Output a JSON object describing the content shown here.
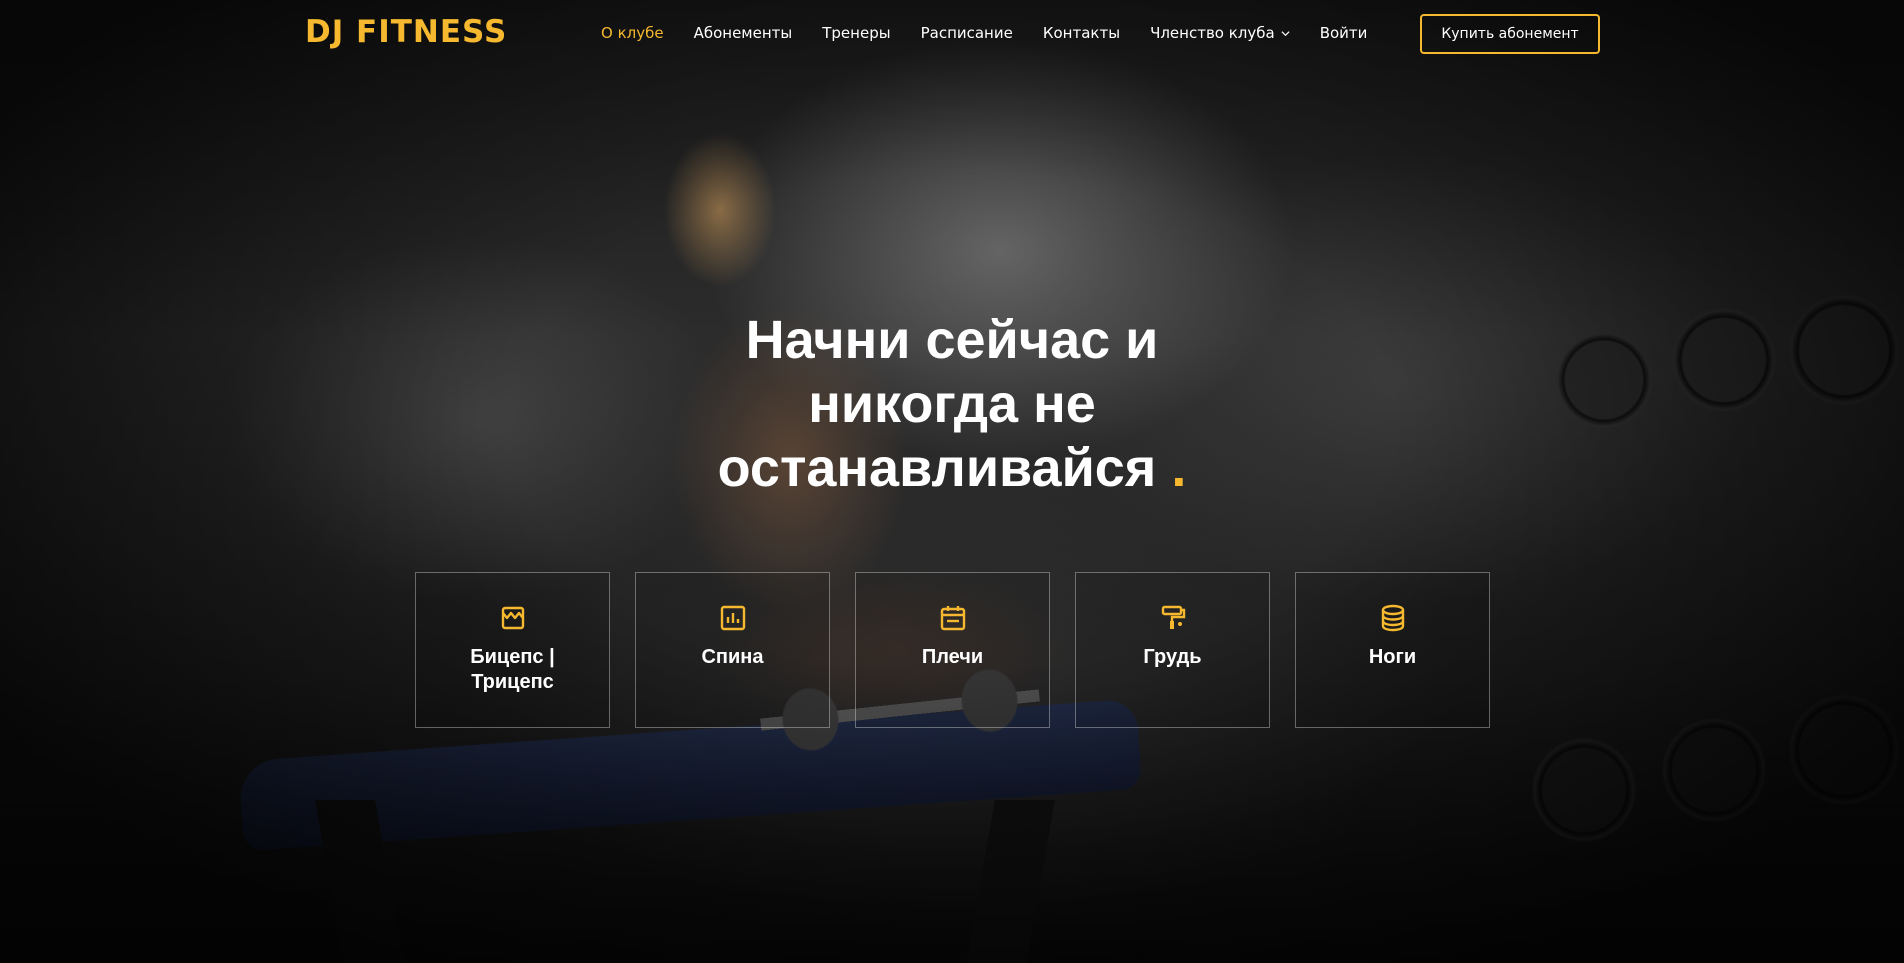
{
  "brand": {
    "logo": "DJ FITNESS",
    "accent_color": "#f5b82e"
  },
  "nav": {
    "items": [
      {
        "label": "О клубе",
        "active": true
      },
      {
        "label": "Абонементы",
        "active": false
      },
      {
        "label": "Тренеры",
        "active": false
      },
      {
        "label": "Расписание",
        "active": false
      },
      {
        "label": "Контакты",
        "active": false
      },
      {
        "label": "Членство клуба",
        "active": false,
        "dropdown": true
      },
      {
        "label": "Войти",
        "active": false
      }
    ],
    "cta_label": "Купить абонемент"
  },
  "hero": {
    "title_line1": "Начни сейчас и",
    "title_line2": "никогда не",
    "title_line3": "останавливайся",
    "title_dot": "."
  },
  "categories": [
    {
      "label": "Бицепс | Трицепс",
      "icon": "store-icon"
    },
    {
      "label": "Спина",
      "icon": "bar-chart-icon"
    },
    {
      "label": "Плечи",
      "icon": "calendar-icon"
    },
    {
      "label": "Грудь",
      "icon": "paint-roller-icon"
    },
    {
      "label": "Ноги",
      "icon": "database-icon"
    }
  ]
}
